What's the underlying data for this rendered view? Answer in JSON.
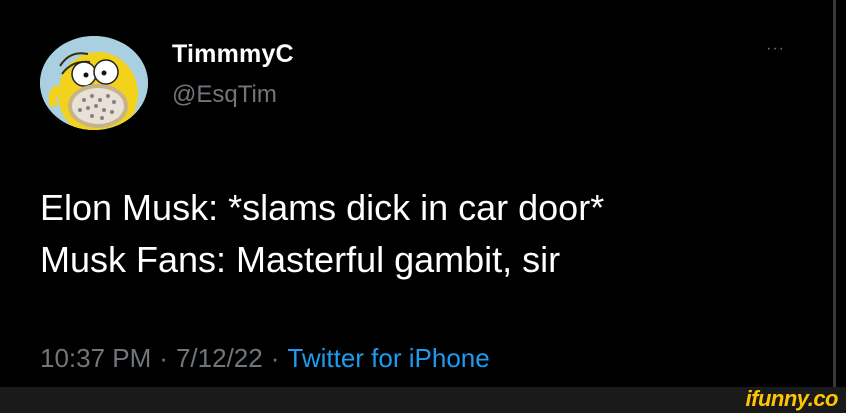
{
  "user": {
    "display_name": "TimmmyC",
    "handle": "@EsqTim",
    "avatar_icon": "homer-simpson-avatar-icon"
  },
  "menu": {
    "more_label": "···"
  },
  "tweet": {
    "line1": "Elon Musk: *slams dick in car door*",
    "line2": "Musk Fans: Masterful gambit, sir"
  },
  "meta": {
    "time": "10:37 PM",
    "separator": "·",
    "date": "7/12/22",
    "source": "Twitter for iPhone"
  },
  "watermark": "ifunny.co",
  "colors": {
    "background": "#000000",
    "text": "#ffffff",
    "muted": "#71767b",
    "link": "#1d9bf0",
    "watermark": "#ffc600"
  }
}
